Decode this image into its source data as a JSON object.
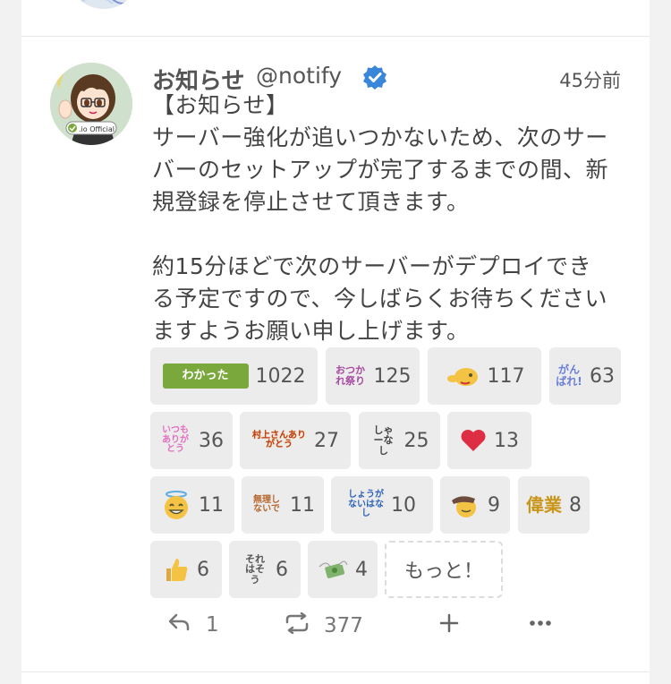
{
  "post": {
    "display_name": "お知らせ",
    "username": "@notify",
    "time": "45分前",
    "avatar_badge": ".io Official",
    "body": "【お知らせ】\nサーバー強化が追いつかないため、次のサー\nバーのセットアップが完了するまでの間、新\n規登録を停止させて頂きます。\n\n約15分ほどで次のサーバーがデプロイでき\nる予定ですので、今しばらくお待ちください\nますようお願い申し上げます。"
  },
  "reactions": [
    {
      "icon": "wakatta-text-emoji",
      "emoji_text": "わかった",
      "count": "1022"
    },
    {
      "icon": "otsukare-matsuri-text-emoji",
      "emoji_text": "おつかれ祭り",
      "count": "125"
    },
    {
      "icon": "whistle-face-emoji",
      "count": "117"
    },
    {
      "icon": "ganbare-text-emoji",
      "emoji_text": "がんばれ!",
      "count": "63"
    },
    {
      "icon": "itsumo-arigatou-text-emoji",
      "emoji_text": "いつもありがとう",
      "count": "36"
    },
    {
      "icon": "murakami-san-arigatou-text-emoji",
      "emoji_text": "村上さんありがとう",
      "count": "27"
    },
    {
      "icon": "shaanai-text-emoji",
      "emoji_text": "しゃーなし",
      "count": "25"
    },
    {
      "icon": "red-heart-emoji",
      "count": "13"
    },
    {
      "icon": "halo-smile-emoji",
      "count": "11"
    },
    {
      "icon": "muri-shinaide-text-emoji",
      "emoji_text": "無理しないで",
      "count": "11"
    },
    {
      "icon": "shouganai-text-emoji",
      "emoji_text": "しょうがないはなし",
      "count": "10"
    },
    {
      "icon": "pat-head-emoji",
      "count": "9"
    },
    {
      "icon": "igyou-text-emoji",
      "emoji_text": "偉業",
      "count": "8"
    },
    {
      "icon": "thumbs-up-emoji",
      "count": "6"
    },
    {
      "icon": "sorewa-sou-text-emoji",
      "emoji_text": "それはそう",
      "count": "6"
    },
    {
      "icon": "money-wings-emoji",
      "count": "4"
    }
  ],
  "more_label": "もっと！",
  "actions": {
    "reply_count": "1",
    "renote_count": "377"
  },
  "colors": {
    "wakatta_green": "#7aa83d",
    "verified_blue": "#3a86d8",
    "reaction_bg": "#ececec"
  }
}
